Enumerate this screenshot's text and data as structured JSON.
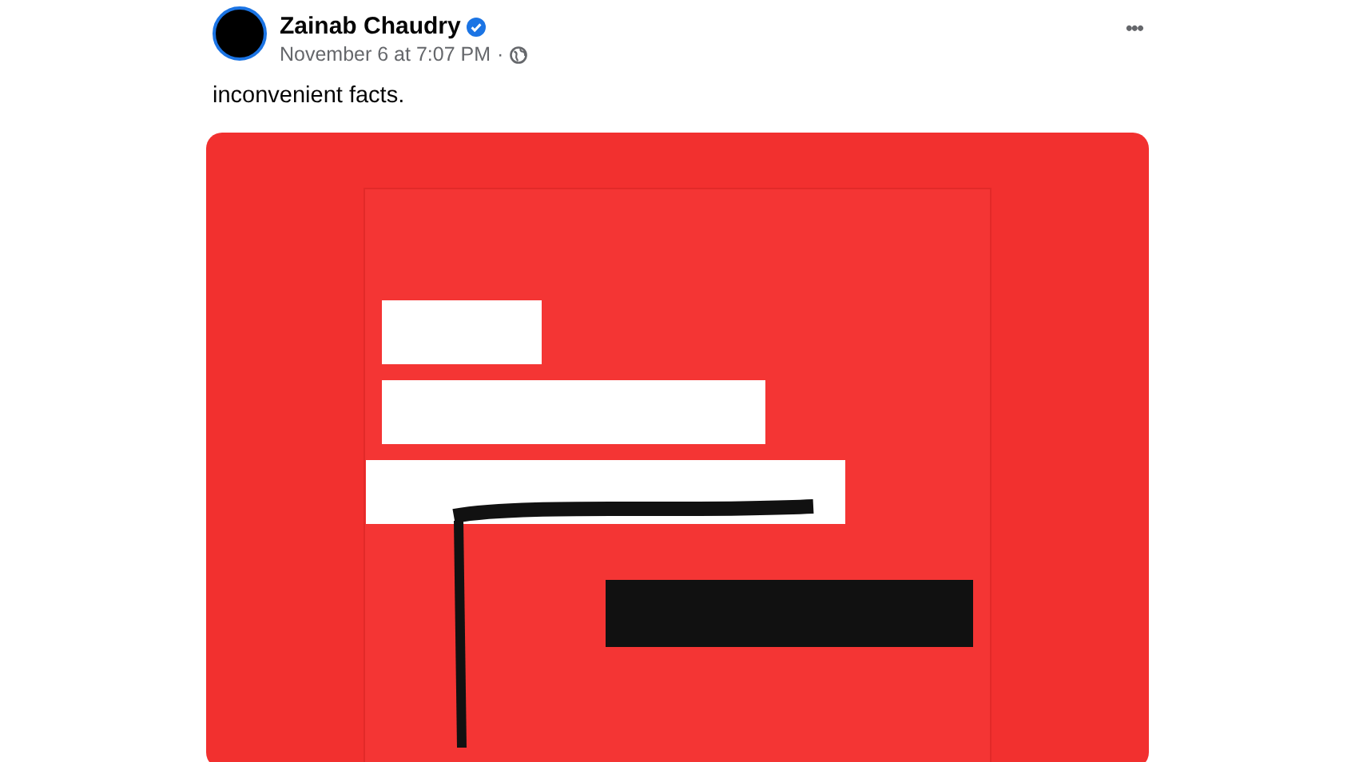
{
  "post": {
    "author": "Zainab Chaudry",
    "verified": true,
    "timestamp": "November 6 at 7:07 PM",
    "separator": "·",
    "audience_icon": true,
    "menu": "•••",
    "text": "inconvenient facts."
  }
}
